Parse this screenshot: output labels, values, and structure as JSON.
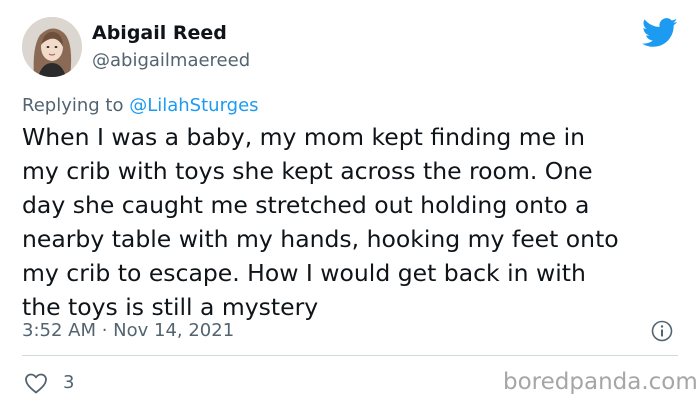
{
  "tweet": {
    "author": {
      "display_name": "Abigail Reed",
      "handle": "@abigailmaereed"
    },
    "reply_prefix": "Replying to ",
    "reply_to": "@LilahSturges",
    "text": "When I was a baby, my mom kept finding me in\nmy crib with toys she  kept across the room. One\nday she caught me stretched out holding onto a\nnearby table with my hands, hooking my feet onto\nmy crib to escape. How I would get back in with\nthe toys is still a mystery",
    "timestamp": "3:52 AM · Nov 14, 2021",
    "likes": "3"
  },
  "icons": {
    "brand": "twitter-bird-icon",
    "info": "info-icon",
    "like": "heart-icon"
  },
  "colors": {
    "twitter_blue": "#1d9bf0",
    "text_primary": "#0f1419",
    "text_secondary": "#536471",
    "divider": "#cfd9de",
    "watermark": "#a6a6a6"
  },
  "watermark": "boredpanda.com"
}
